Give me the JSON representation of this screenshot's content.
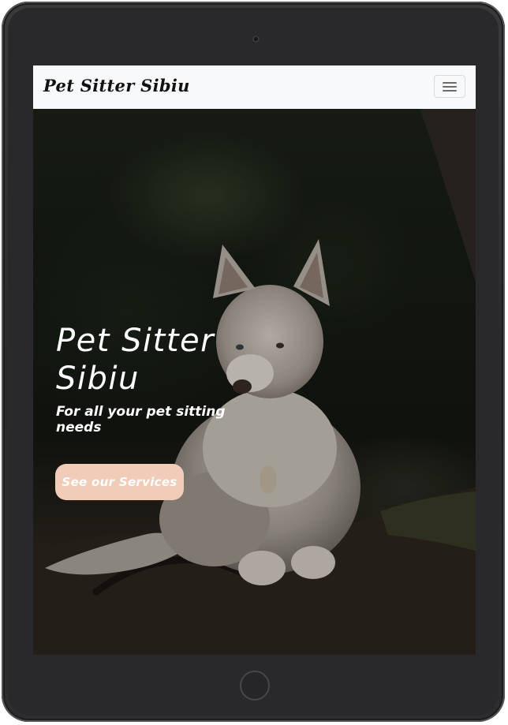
{
  "navbar": {
    "brand": "Pet Sitter Sibiu",
    "toggler_icon": "hamburger-menu-icon"
  },
  "hero": {
    "title": "Pet Sitter Sibiu",
    "subtitle": "For all your pet sitting needs",
    "cta_label": "See our Services"
  },
  "device": {
    "camera_icon": "camera-icon",
    "home_button_icon": "home-button-icon"
  },
  "colors": {
    "navbar_bg": "#f8f9fa",
    "cta_bg": "#f1ccb8",
    "hero_text": "#ffffff",
    "device_frame": "#29292b"
  }
}
